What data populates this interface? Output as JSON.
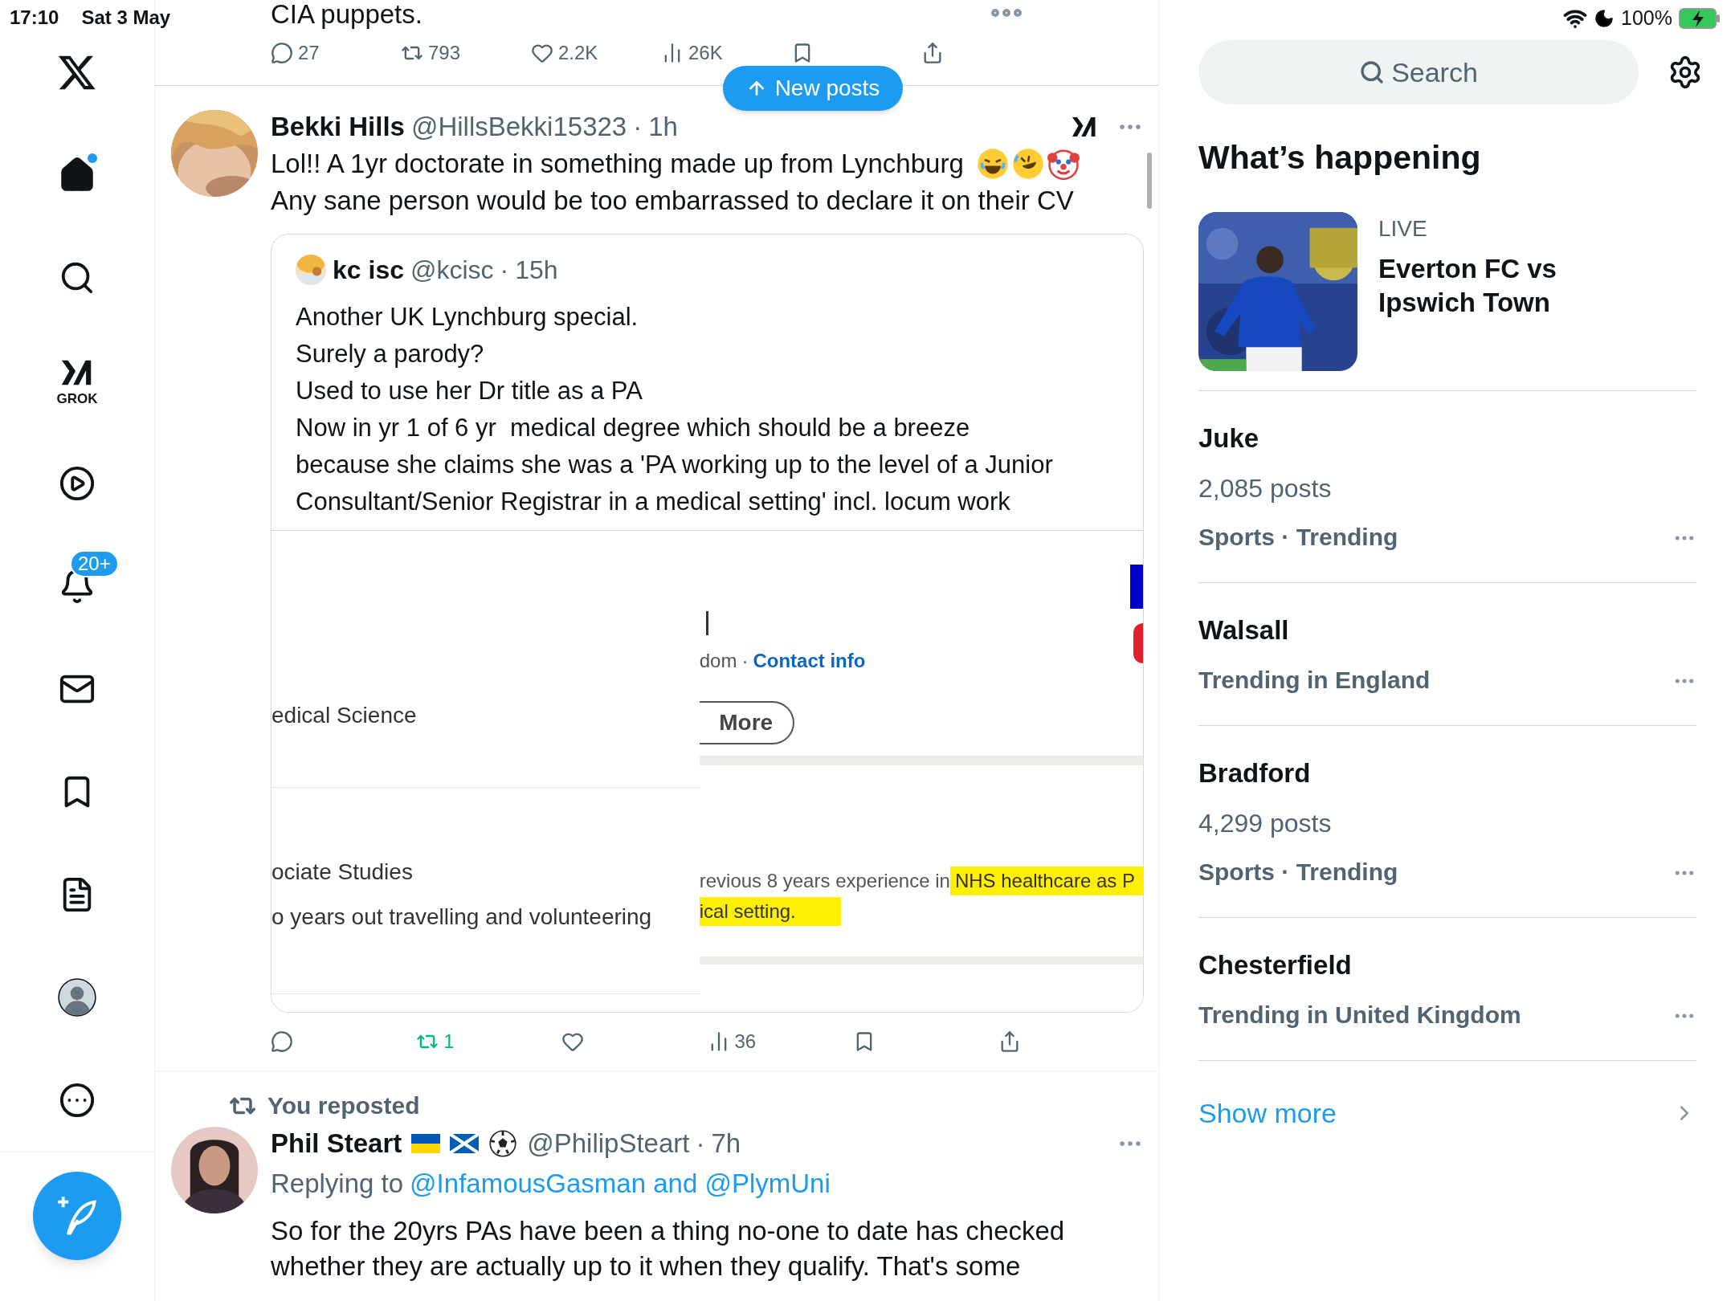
{
  "status_bar": {
    "time": "17:10",
    "date": "Sat 3 May",
    "battery": "100%"
  },
  "sidebar": {
    "items": [
      {
        "kind": "home",
        "selected": true,
        "unread": true
      },
      {
        "kind": "search",
        "selected": false,
        "unread": false
      },
      {
        "kind": "grok",
        "selected": false,
        "unread": false,
        "label": "GROK"
      },
      {
        "kind": "video",
        "selected": false,
        "unread": false
      },
      {
        "kind": "notifications",
        "selected": false,
        "unread": false,
        "badge": "20+"
      },
      {
        "kind": "messages",
        "selected": false,
        "unread": false
      },
      {
        "kind": "bookmarks",
        "selected": false,
        "unread": false
      },
      {
        "kind": "lists",
        "selected": false,
        "unread": false
      },
      {
        "kind": "profile",
        "selected": false,
        "unread": false
      },
      {
        "kind": "more",
        "selected": false,
        "unread": false
      }
    ]
  },
  "feed": {
    "new_posts": "New posts",
    "previous_post": {
      "text": "CIA puppets.",
      "actions": [
        {
          "kind": "reply",
          "count": "27",
          "active": false
        },
        {
          "kind": "repost",
          "count": "793",
          "active": false
        },
        {
          "kind": "like",
          "count": "2.2K",
          "active": false
        },
        {
          "kind": "views",
          "count": "26K",
          "active": false
        },
        {
          "kind": "bookmark",
          "active": false
        },
        {
          "kind": "share",
          "active": false
        }
      ]
    },
    "posts": [
      {
        "name": "Bekki Hills",
        "handle": "@HillsBekki15323",
        "separator": "·",
        "time": "1h",
        "lines": [
          "Lol!! A 1yr doctorate in something made up from Lynchburg",
          "Any sane person would be too embarrassed to declare it on their CV"
        ],
        "quote": {
          "name": "kc isc",
          "handle": "@kcisc",
          "separator": "·",
          "time": "15h",
          "lines": [
            "Another UK Lynchburg special.",
            "Surely a parody?",
            "Used to use her Dr title as a PA",
            "Now in yr 1 of 6 yr  medical degree which should be a breeze",
            "because she claims she was a 'PA working up to the level of a Junior",
            "Consultant/Senior Registrar in a medical setting' incl. locum work"
          ],
          "screenshot": {
            "left_texts": [
              "edical Science",
              "ociate Studies",
              "o years out travelling and volunteering"
            ],
            "location": "dom",
            "separator": "·",
            "contact": "Contact info",
            "more_button": "More",
            "experience": "revious 8 years experience in",
            "highlights": [
              "NHS healthcare as P",
              "ical setting."
            ]
          }
        },
        "actions": [
          {
            "kind": "reply",
            "active": false
          },
          {
            "kind": "repost",
            "count": "1",
            "active": true
          },
          {
            "kind": "like",
            "active": false
          },
          {
            "kind": "views",
            "count": "36",
            "active": false
          },
          {
            "kind": "bookmark",
            "active": false
          },
          {
            "kind": "share",
            "active": false
          }
        ]
      },
      {
        "reposted_by": "You reposted",
        "name": "Phil Steart",
        "handle": "@PhilipSteart",
        "separator": "·",
        "time": "7h",
        "replying_prefix": "Replying to",
        "replying_to": "@InfamousGasman and @PlymUni",
        "lines": [
          "So for the 20yrs PAs have been a thing no-one to date has checked",
          "whether they are actually up to it when they qualify. That's some"
        ]
      }
    ]
  },
  "right": {
    "search": {
      "placeholder": "Search"
    },
    "title": "What’s happening",
    "live": {
      "label": "LIVE",
      "title": "Everton FC vs Ipswich Town"
    },
    "trends": [
      {
        "name": "Juke",
        "posts": "2,085 posts",
        "context": "Sports · Trending"
      },
      {
        "name": "Walsall",
        "context": "Trending in England"
      },
      {
        "name": "Bradford",
        "posts": "4,299 posts",
        "context": "Sports · Trending"
      },
      {
        "name": "Chesterfield",
        "context": "Trending in United Kingdom"
      }
    ],
    "show_more": "Show more"
  }
}
